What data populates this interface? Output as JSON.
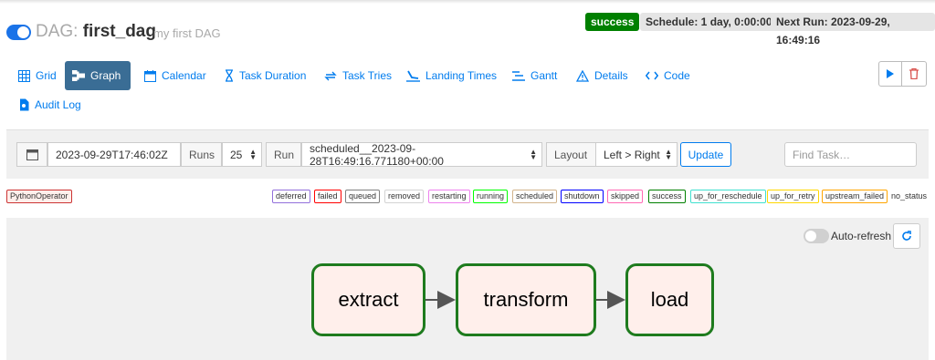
{
  "header": {
    "dag_prefix": "DAG:",
    "dag_id": "first_dag",
    "description": "my first DAG",
    "status": "success",
    "schedule": "Schedule: 1 day, 0:00:00",
    "next_run": "Next Run: 2023-09-29, 16:49:16",
    "colors": {
      "toggle": "#1a73e8",
      "status": "#008000"
    }
  },
  "tabs": [
    {
      "label": "Grid",
      "icon": "grid-icon"
    },
    {
      "label": "Graph",
      "icon": "graph-icon",
      "active": true
    },
    {
      "label": "Calendar",
      "icon": "calendar-icon"
    },
    {
      "label": "Task Duration",
      "icon": "hourglass-icon"
    },
    {
      "label": "Task Tries",
      "icon": "retry-icon"
    },
    {
      "label": "Landing Times",
      "icon": "plane-landing-icon"
    },
    {
      "label": "Gantt",
      "icon": "gantt-icon"
    },
    {
      "label": "Details",
      "icon": "warning-triangle-icon"
    },
    {
      "label": "Code",
      "icon": "code-icon"
    },
    {
      "label": "Audit Log",
      "icon": "document-search-icon"
    }
  ],
  "actions": {
    "trigger": "play-icon",
    "delete": "trash-icon"
  },
  "filters": {
    "base_date": "2023-09-29T17:46:02Z",
    "runs_label": "Runs",
    "runs_value": "25",
    "run_label": "Run",
    "run_value": "scheduled__2023-09-28T16:49:16.771180+00:00",
    "layout_label": "Layout",
    "layout_value": "Left > Right",
    "update_label": "Update",
    "find_placeholder": "Find Task…"
  },
  "legend": {
    "operator": "PythonOperator",
    "statuses": [
      {
        "label": "deferred",
        "color": "#9370db"
      },
      {
        "label": "failed",
        "color": "#ff0000"
      },
      {
        "label": "queued",
        "color": "#808080"
      },
      {
        "label": "removed",
        "color": "#d3d3d3"
      },
      {
        "label": "restarting",
        "color": "#ee82ee"
      },
      {
        "label": "running",
        "color": "#00ff00"
      },
      {
        "label": "scheduled",
        "color": "#d2b48c"
      },
      {
        "label": "shutdown",
        "color": "#0000ff"
      },
      {
        "label": "skipped",
        "color": "#ff69b4"
      },
      {
        "label": "success",
        "color": "#008000"
      },
      {
        "label": "up_for_reschedule",
        "color": "#40e0d0"
      },
      {
        "label": "up_for_retry",
        "color": "#ffd700"
      },
      {
        "label": "upstream_failed",
        "color": "#ffa500"
      }
    ],
    "no_status": "no_status"
  },
  "graph": {
    "auto_refresh_label": "Auto-refresh",
    "nodes": [
      "extract",
      "transform",
      "load"
    ]
  }
}
